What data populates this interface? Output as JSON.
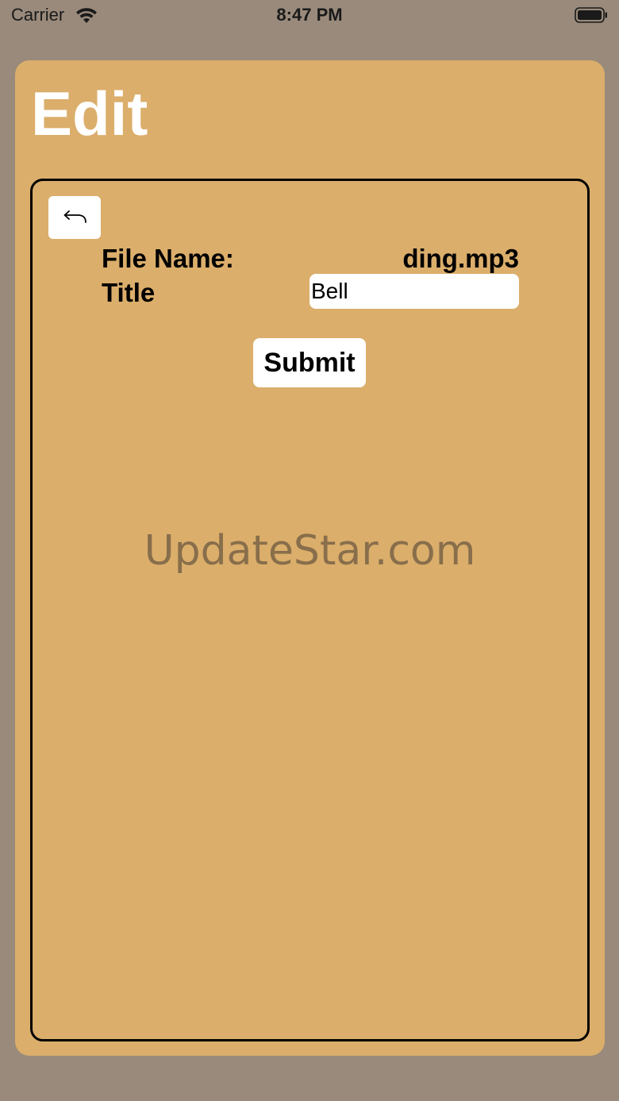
{
  "status_bar": {
    "carrier": "Carrier",
    "time": "8:47 PM",
    "icons": [
      "wifi-icon",
      "battery-icon"
    ]
  },
  "header": {
    "title": "Edit"
  },
  "form": {
    "back_icon": "back-arrow-icon",
    "file_name_label": "File Name:",
    "file_name_value": "ding.mp3",
    "title_label": "Title",
    "title_value": "Bell",
    "submit_label": "Submit"
  },
  "watermark": "UpdateStar.com",
  "colors": {
    "background": "#998a7b",
    "card": "#dbae6b",
    "title_text": "#ffffff",
    "panel_border": "#000000"
  }
}
